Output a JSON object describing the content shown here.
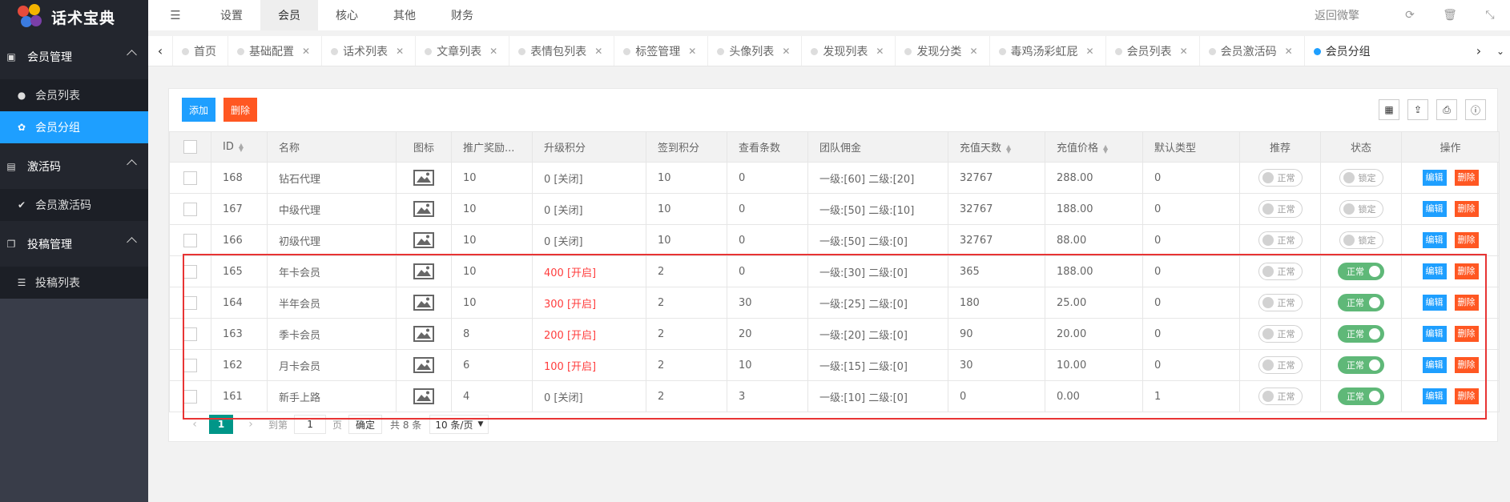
{
  "app": {
    "title": "话术宝典"
  },
  "sidebar": {
    "groups": [
      {
        "label": "会员管理",
        "items": [
          {
            "label": "会员列表"
          },
          {
            "label": "会员分组"
          }
        ]
      },
      {
        "label": "激活码",
        "items": [
          {
            "label": "会员激活码"
          }
        ]
      },
      {
        "label": "投稿管理",
        "items": [
          {
            "label": "投稿列表"
          }
        ]
      }
    ]
  },
  "topnav": {
    "items": [
      "设置",
      "会员",
      "核心",
      "其他",
      "财务"
    ],
    "active": "会员",
    "return_label": "返回微擎"
  },
  "tabs": [
    "首页",
    "基础配置",
    "话术列表",
    "文章列表",
    "表情包列表",
    "标签管理",
    "头像列表",
    "发现列表",
    "发现分类",
    "毒鸡汤彩虹屁",
    "会员列表",
    "会员激活码",
    "会员分组"
  ],
  "toolbar": {
    "add_label": "添加",
    "delete_label": "删除"
  },
  "table": {
    "columns": [
      "ID",
      "名称",
      "图标",
      "推广奖励...",
      "升级积分",
      "签到积分",
      "查看条数",
      "团队佣金",
      "充值天数",
      "充值价格",
      "默认类型",
      "推荐",
      "状态",
      "操作"
    ],
    "rows": [
      {
        "id": "168",
        "name": "钻石代理",
        "reward": "10",
        "upgrade": "0 [关闭]",
        "upgrade_on": false,
        "checkin": "10",
        "views": "0",
        "commission": "一级:[60] 二级:[20]",
        "days": "32767",
        "price": "288.00",
        "default": "0",
        "recommend": "正常",
        "status": "锁定",
        "status_on": false
      },
      {
        "id": "167",
        "name": "中级代理",
        "reward": "10",
        "upgrade": "0 [关闭]",
        "upgrade_on": false,
        "checkin": "10",
        "views": "0",
        "commission": "一级:[50] 二级:[10]",
        "days": "32767",
        "price": "188.00",
        "default": "0",
        "recommend": "正常",
        "status": "锁定",
        "status_on": false
      },
      {
        "id": "166",
        "name": "初级代理",
        "reward": "10",
        "upgrade": "0 [关闭]",
        "upgrade_on": false,
        "checkin": "10",
        "views": "0",
        "commission": "一级:[50] 二级:[0]",
        "days": "32767",
        "price": "88.00",
        "default": "0",
        "recommend": "正常",
        "status": "锁定",
        "status_on": false
      },
      {
        "id": "165",
        "name": "年卡会员",
        "reward": "10",
        "upgrade": "400 [开启]",
        "upgrade_on": true,
        "checkin": "2",
        "views": "0",
        "commission": "一级:[30] 二级:[0]",
        "days": "365",
        "price": "188.00",
        "default": "0",
        "recommend": "正常",
        "status": "正常",
        "status_on": true
      },
      {
        "id": "164",
        "name": "半年会员",
        "reward": "10",
        "upgrade": "300 [开启]",
        "upgrade_on": true,
        "checkin": "2",
        "views": "30",
        "commission": "一级:[25] 二级:[0]",
        "days": "180",
        "price": "25.00",
        "default": "0",
        "recommend": "正常",
        "status": "正常",
        "status_on": true
      },
      {
        "id": "163",
        "name": "季卡会员",
        "reward": "8",
        "upgrade": "200 [开启]",
        "upgrade_on": true,
        "checkin": "2",
        "views": "20",
        "commission": "一级:[20] 二级:[0]",
        "days": "90",
        "price": "20.00",
        "default": "0",
        "recommend": "正常",
        "status": "正常",
        "status_on": true
      },
      {
        "id": "162",
        "name": "月卡会员",
        "reward": "6",
        "upgrade": "100 [开启]",
        "upgrade_on": true,
        "checkin": "2",
        "views": "10",
        "commission": "一级:[15] 二级:[0]",
        "days": "30",
        "price": "10.00",
        "default": "0",
        "recommend": "正常",
        "status": "正常",
        "status_on": true
      },
      {
        "id": "161",
        "name": "新手上路",
        "reward": "4",
        "upgrade": "0 [关闭]",
        "upgrade_on": false,
        "checkin": "2",
        "views": "3",
        "commission": "一级:[10] 二级:[0]",
        "days": "0",
        "price": "0.00",
        "default": "1",
        "recommend": "正常",
        "status": "正常",
        "status_on": true
      }
    ],
    "row_actions": {
      "edit": "编辑",
      "delete": "删除"
    }
  },
  "pagination": {
    "current": "1",
    "goto_label": "到第",
    "page_value": "1",
    "page_unit": "页",
    "confirm": "确定",
    "total": "共 8 条",
    "page_size": "10 条/页"
  },
  "colors": {
    "blue": "#1e9fff",
    "red": "#ff5722",
    "green": "#5fb878",
    "teal": "#009688",
    "sidebar": "#393d49",
    "highlight": "#ff3d3d"
  }
}
